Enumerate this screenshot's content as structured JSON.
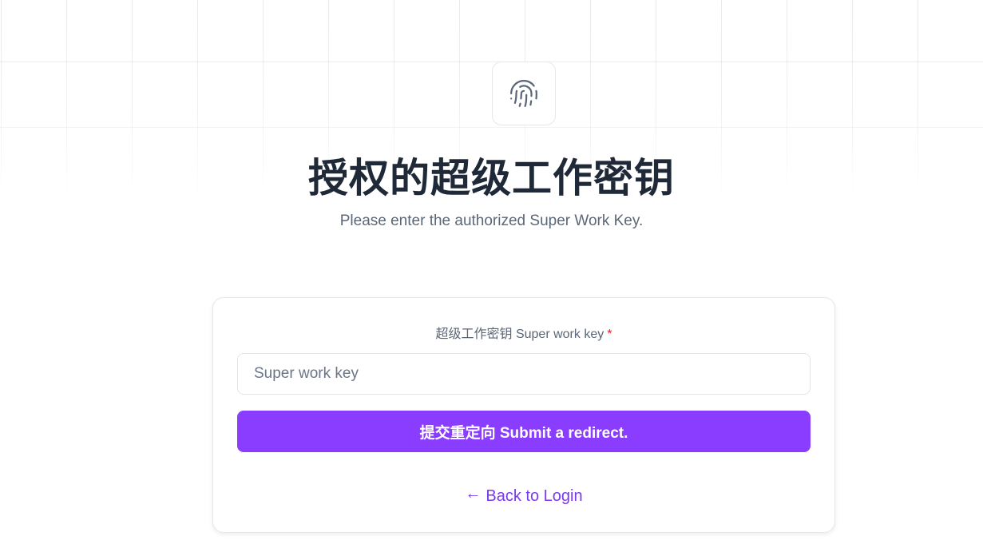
{
  "header": {
    "logo_icon": "fingerprint-icon",
    "title": "授权的超级工作密钥",
    "subtitle": "Please enter the authorized Super Work Key."
  },
  "form": {
    "label": "超级工作密钥 Super work key",
    "required_marker": "*",
    "input": {
      "placeholder": "Super work key",
      "value": ""
    },
    "submit_label": "提交重定向 Submit a redirect.",
    "back_icon": "arrow-left-icon",
    "back_arrow": "←",
    "back_label": "Back to Login"
  },
  "colors": {
    "accent": "#8b3dff",
    "link": "#7c3aed",
    "required": "#dc2626",
    "title": "#1f2937",
    "grid": "#c4b5fd"
  }
}
